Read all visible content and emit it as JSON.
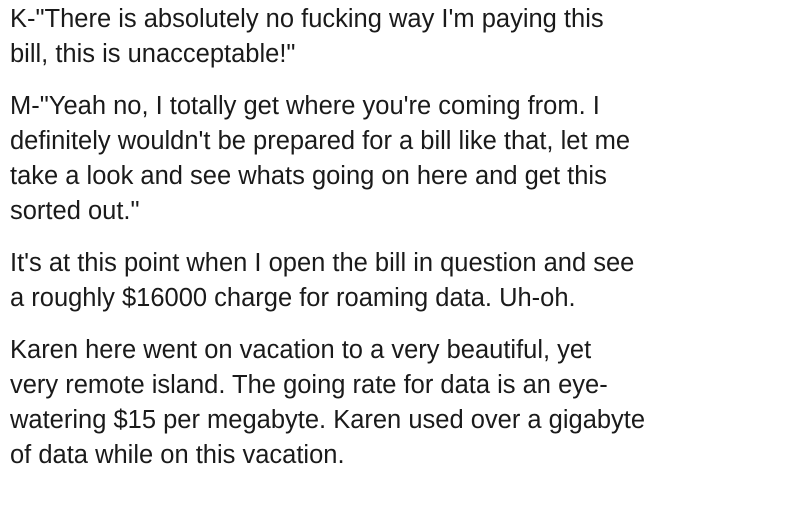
{
  "paragraphs": [
    {
      "lines": [
        "K-\"There is absolutely no fucking way I'm paying this",
        "bill, this is unacceptable!\""
      ]
    },
    {
      "lines": [
        "M-\"Yeah no, I totally get where you're coming from. I",
        "definitely wouldn't be prepared for a bill like that, let me",
        "take a look and see whats going on here and get this",
        "sorted out.\""
      ]
    },
    {
      "lines": [
        "It's at this point when I open the bill in question and see",
        "a roughly $16000 charge for roaming data. Uh-oh."
      ]
    },
    {
      "lines": [
        "Karen here went on vacation to a very beautiful, yet",
        "very remote island. The going rate for data is an eye-",
        "watering $15 per megabyte. Karen used over a gigabyte",
        "of data while on this vacation."
      ]
    }
  ]
}
